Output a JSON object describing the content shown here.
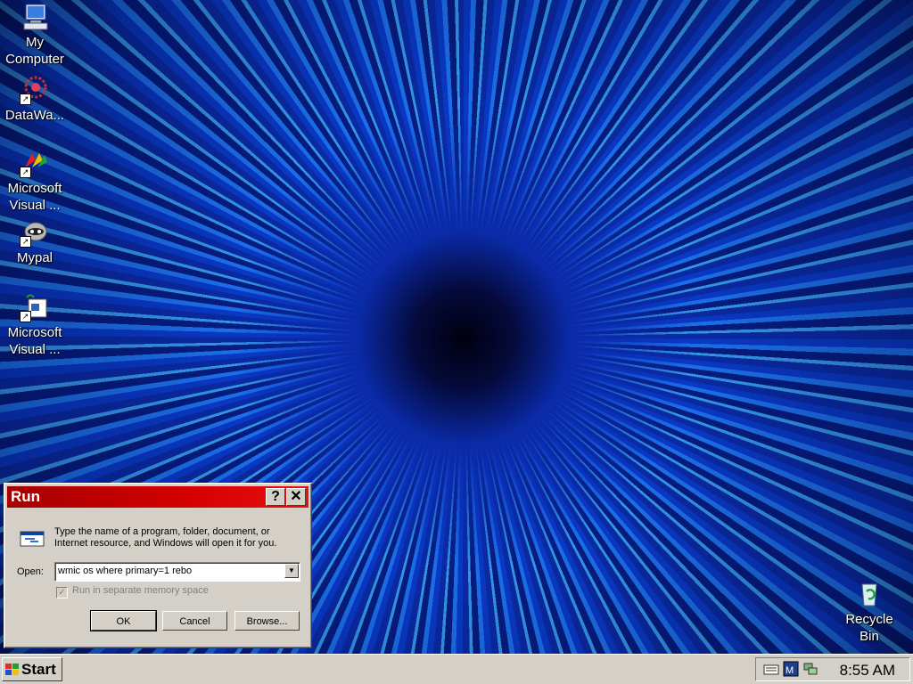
{
  "desktop": {
    "icons": [
      {
        "label": "My\nComputer",
        "icon": "my-computer-icon"
      },
      {
        "label": "DataWa...",
        "icon": "datawa-icon"
      },
      {
        "label": "Microsoft\nVisual ...",
        "icon": "visual-studio-icon"
      },
      {
        "label": "Mypal",
        "icon": "mypal-icon"
      },
      {
        "label": "Microsoft\nVisual ...",
        "icon": "visual-basic-icon"
      },
      {
        "label": "Recycle\nBin",
        "icon": "recycle-bin-icon"
      }
    ]
  },
  "run_dialog": {
    "title": "Run",
    "help_label": "?",
    "close_label": "✕",
    "description": "Type the name of a program, folder, document, or Internet resource, and Windows will open it for you.",
    "open_label": "Open:",
    "open_value": "wmic os where primary=1 rebo",
    "checkbox_label": "Run in separate memory space",
    "checkbox_checked": true,
    "ok_label": "OK",
    "cancel_label": "Cancel",
    "browse_label": "Browse..."
  },
  "taskbar": {
    "start_label": "Start",
    "clock": "8:55 AM",
    "tray_icons": [
      "keyboard-icon",
      "vm-tools-icon",
      "network-icon"
    ]
  },
  "colors": {
    "titlebar": "#c00000",
    "dialog_face": "#d4d0c8",
    "desktop_blue": "#0a3fd8"
  }
}
